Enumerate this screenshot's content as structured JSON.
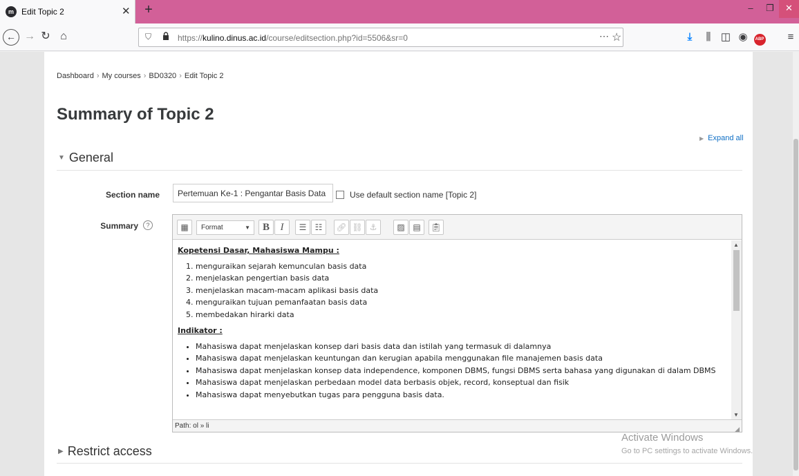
{
  "browser": {
    "tab_title": "Edit Topic 2",
    "tab_favicon": "m",
    "url_host": "kulino.dinus.ac.id",
    "url_prefix": "https://",
    "url_suffix": "/course/editsection.php?id=5506&sr=0"
  },
  "breadcrumb": [
    "Dashboard",
    "My courses",
    "BD0320",
    "Edit Topic 2"
  ],
  "page_title": "Summary of Topic 2",
  "expand_all": "Expand all",
  "general_section": "General",
  "form": {
    "section_name_label": "Section name",
    "section_name_value": "Pertemuan Ke-1 : Pengantar Basis Data",
    "use_default_label": "Use default section name [Topic 2]",
    "summary_label": "Summary"
  },
  "editor": {
    "format_label": "Format",
    "heading1": "Kopetensi Dasar, Mahasiswa Mampu :",
    "list1": [
      "menguraikan sejarah kemunculan basis data",
      "menjelaskan pengertian basis data",
      "menjelaskan macam-macam aplikasi basis data",
      "menguraikan tujuan pemanfaatan basis data",
      "membedakan hirarki data"
    ],
    "heading2": "Indikator :",
    "list2": [
      "Mahasiswa dapat menjelaskan konsep dari basis data dan istilah yang termasuk di dalamnya",
      "Mahasiswa dapat menjelaskan keuntungan dan  kerugian apabila menggunakan file manajemen basis data",
      "Mahasiswa dapat menjelaskan konsep data independence, komponen DBMS, fungsi DBMS serta bahasa yang digunakan di dalam DBMS",
      "Mahasiswa dapat menjelaskan perbedaan model data berbasis objek, record, konseptual dan fisik",
      "Mahasiswa dapat menyebutkan tugas para pengguna basis data."
    ],
    "path": "Path: ol » li"
  },
  "restrict_section": "Restrict access",
  "watermark": {
    "line1": "Activate Windows",
    "line2": "Go to PC settings to activate Windows."
  },
  "icons": {
    "download": "download-icon",
    "library": "library-icon",
    "sidebar": "sidebar-icon",
    "account": "account-icon",
    "adblock": "adblock-icon",
    "menu": "hamburger-menu-icon"
  },
  "colors": {
    "tabbar": "#d26098",
    "link": "#0f6fc5",
    "download": "#0a84ff"
  }
}
